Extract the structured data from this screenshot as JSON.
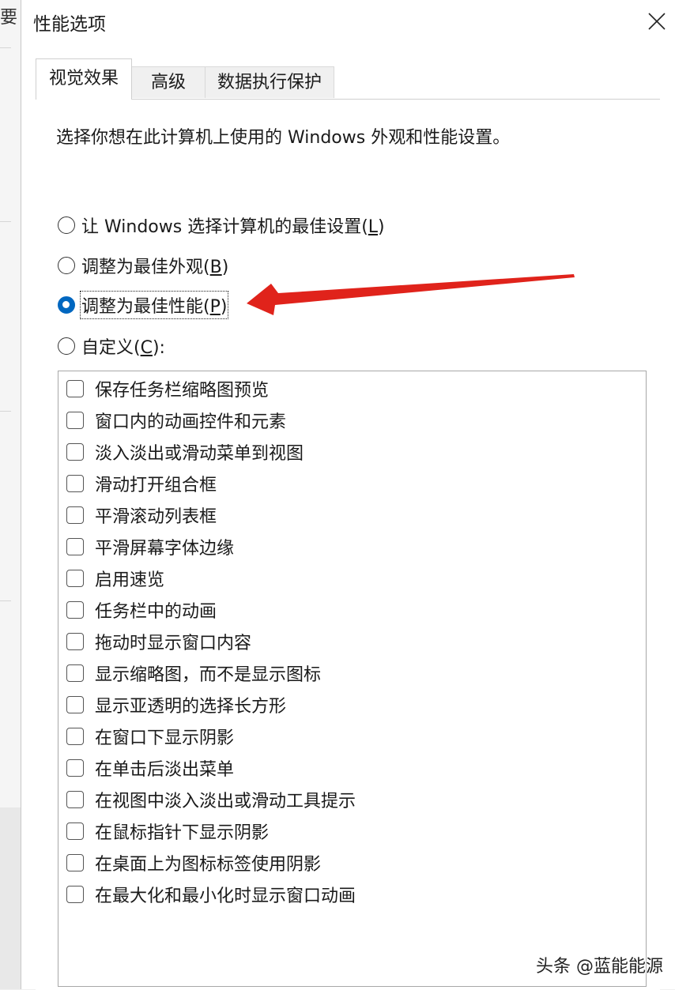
{
  "background": {
    "glyph": "要"
  },
  "dialog": {
    "title": "性能选项",
    "close_icon": "close-icon"
  },
  "tabs": [
    {
      "label": "视觉效果",
      "active": true
    },
    {
      "label": "高级",
      "active": false
    },
    {
      "label": "数据执行保护",
      "active": false
    }
  ],
  "intro": "选择你想在此计算机上使用的 Windows 外观和性能设置。",
  "radios": [
    {
      "prefix": "让 Windows 选择计算机的最佳设置(",
      "key": "L",
      "suffix": ")",
      "checked": false
    },
    {
      "prefix": "调整为最佳外观(",
      "key": "B",
      "suffix": ")",
      "checked": false
    },
    {
      "prefix": "调整为最佳性能(",
      "key": "P",
      "suffix": ")",
      "checked": true
    },
    {
      "prefix": "自定义(",
      "key": "C",
      "suffix": "):",
      "checked": false
    }
  ],
  "options": [
    {
      "label": "保存任务栏缩略图预览",
      "checked": false
    },
    {
      "label": "窗口内的动画控件和元素",
      "checked": false
    },
    {
      "label": "淡入淡出或滑动菜单到视图",
      "checked": false
    },
    {
      "label": "滑动打开组合框",
      "checked": false
    },
    {
      "label": "平滑滚动列表框",
      "checked": false
    },
    {
      "label": "平滑屏幕字体边缘",
      "checked": false
    },
    {
      "label": "启用速览",
      "checked": false
    },
    {
      "label": "任务栏中的动画",
      "checked": false
    },
    {
      "label": "拖动时显示窗口内容",
      "checked": false
    },
    {
      "label": "显示缩略图，而不是显示图标",
      "checked": false
    },
    {
      "label": "显示亚透明的选择长方形",
      "checked": false
    },
    {
      "label": "在窗口下显示阴影",
      "checked": false
    },
    {
      "label": "在单击后淡出菜单",
      "checked": false
    },
    {
      "label": "在视图中淡入淡出或滑动工具提示",
      "checked": false
    },
    {
      "label": "在鼠标指针下显示阴影",
      "checked": false
    },
    {
      "label": "在桌面上为图标标签使用阴影",
      "checked": false
    },
    {
      "label": "在最大化和最小化时显示窗口动画",
      "checked": false
    }
  ],
  "annotation": {
    "arrow_color": "#e0231b"
  },
  "watermark": "头条 @蓝能能源",
  "colors": {
    "accent": "#0067c0",
    "window_bg": "#ffffff",
    "tab_inactive": "#f0f0f0"
  }
}
